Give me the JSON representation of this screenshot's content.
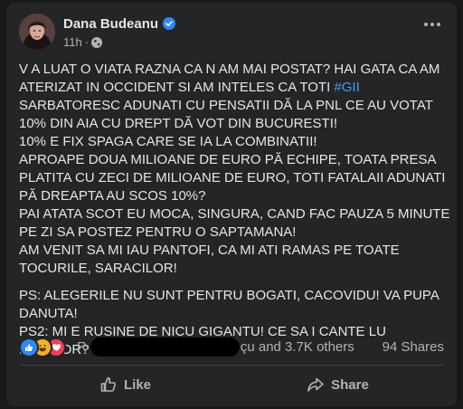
{
  "post": {
    "author": "Dana Budeanu",
    "time": "11h",
    "separator": "·",
    "text": {
      "p1_a": "V A LUAT O VIATA RAZNA CA N AM MAI POSTAT? HAI GATA CA AM ATERIZAT IN OCCIDENT SI AM INTELES CA TOTI ",
      "p1_hashtag": "#GII",
      "p1_b": " SARBATORESC ADUNATI CU PENSATII DĂ LA PNL CE AU VOTAT 10% DIN AIA CU DREPT DĂ VOT DIN BUCURESTI!",
      "p2": "10% E FIX SPAGA CARE SE IA LA COMBINATII!",
      "p3": "APROAPE DOUA MILIOANE DE EURO PĂ ECHIPE, TOATA PRESA PLATITA CU ZECI DE MILIOANE DE EURO, TOTI FATALAII ADUNATI PĂ DREAPTA AU SCOS 10%?",
      "p4": "PAI ATATA SCOT EU MOCA, SINGURA, CAND FAC PAUZA 5 MINUTE PE ZI SA POSTEZ PENTRU O SAPTAMANA!",
      "p5": "AM VENIT SA MI IAU PANTOFI, CA MI ATI RAMAS PE TOATE TOCURILE, SARACILOR!",
      "p6": "PS: ALEGERILE NU SUNT PENTRU BOGATI, CACOVIDU! VA PUPA DANUTA!",
      "p7": "PS2: MI E RUSINE DE NICU GIGANTU! CE SA I CANTE LU NICUSOR?"
    }
  },
  "reactions": {
    "icons": [
      "like-icon",
      "haha-icon",
      "love-icon"
    ],
    "names_prefix": "R",
    "names_suffix": "çu and 3.7K others",
    "shares": "94 Shares"
  },
  "actions": {
    "like": "Like",
    "share": "Share"
  },
  "colors": {
    "card_bg": "#242526",
    "page_bg": "#18191a",
    "text": "#e4e6eb",
    "secondary": "#b0b3b8",
    "link": "#4599ff",
    "like_blue": "#2d88ff",
    "love_red": "#f33e58",
    "haha_yellow": "#f7b125"
  }
}
